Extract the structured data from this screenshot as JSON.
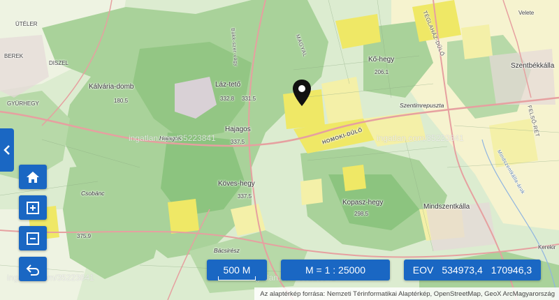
{
  "map": {
    "places": [
      {
        "key": "utiler",
        "name": "ÜTÉLER"
      },
      {
        "key": "berek",
        "name": "BEREK"
      },
      {
        "key": "diszel",
        "name": "DISZEL"
      },
      {
        "key": "gyurhegy",
        "name": "GYÜRHEGY"
      },
      {
        "key": "kalvaria",
        "name": "Kálvária-domb"
      },
      {
        "key": "laz",
        "name": "Láz-tető"
      },
      {
        "key": "hajagos",
        "name": "Hajagos"
      },
      {
        "key": "hajagos2",
        "name": "Hajagos"
      },
      {
        "key": "koves",
        "name": "Köves-hegy"
      },
      {
        "key": "csobanc",
        "name": "Csobánc"
      },
      {
        "key": "bacsi",
        "name": "Bácsirész"
      },
      {
        "key": "ko",
        "name": "Kő-hegy"
      },
      {
        "key": "szentimre",
        "name": "Szentimrepuszta"
      },
      {
        "key": "kopasz",
        "name": "Kopasz-hegy"
      },
      {
        "key": "mindszent",
        "name": "Mindszentkálla"
      },
      {
        "key": "szentbek",
        "name": "Szentbékkálla"
      },
      {
        "key": "veleje",
        "name": "Velete"
      },
      {
        "key": "kerek",
        "name": "Kerekir"
      },
      {
        "key": "magyal",
        "name": "MAGYAL"
      },
      {
        "key": "teglahaz",
        "name": "TÉGLAHÁZ-DŰLŐ"
      },
      {
        "key": "homoki",
        "name": "HOMOKI-DŰLŐ"
      },
      {
        "key": "felso",
        "name": "FELSŐ-RÉT"
      },
      {
        "key": "bukk",
        "name": "Bükk-szer-vágy"
      },
      {
        "key": "arok",
        "name": "Mindszentkálla-árok"
      }
    ],
    "elevations": [
      {
        "key": "e1",
        "value": "180.5"
      },
      {
        "key": "e2",
        "value": "332.8"
      },
      {
        "key": "e3",
        "value": "331.5"
      },
      {
        "key": "e4",
        "value": "337.5"
      },
      {
        "key": "e5",
        "value": "337.5"
      },
      {
        "key": "e6",
        "value": "206.1"
      },
      {
        "key": "e7",
        "value": "298.5"
      },
      {
        "key": "e8",
        "value": "375.9"
      }
    ],
    "watermarks": [
      "ingatlan.com/35223841",
      "ingatlan.com/35223841",
      "ingatlan.com/35223841",
      "ingatlan.com/35223841"
    ]
  },
  "controls": {
    "home": "home-icon",
    "zoom_in": "zoom-in-icon",
    "zoom_out": "zoom-out-icon",
    "back": "undo-icon",
    "side_toggle": "chevron-left-icon"
  },
  "status": {
    "scale_bar": "500 M",
    "ratio": "M = 1 : 25000",
    "coord_label": "EOV",
    "coord_x": "534973,4",
    "coord_y": "170946,3"
  },
  "attribution": "Az alaptérkép forrása: Nemzeti Térinformatikai Alaptérkép, OpenStreetMap, GeoX ArcMagyarország",
  "colors": {
    "accent": "#1a67c3",
    "forest": "#a9d29a",
    "deep_forest": "#8cc47f",
    "field": "#f4f0a8",
    "bright_field": "#efe866",
    "meadow": "#dcecd0",
    "road": "#e6a0a0"
  }
}
